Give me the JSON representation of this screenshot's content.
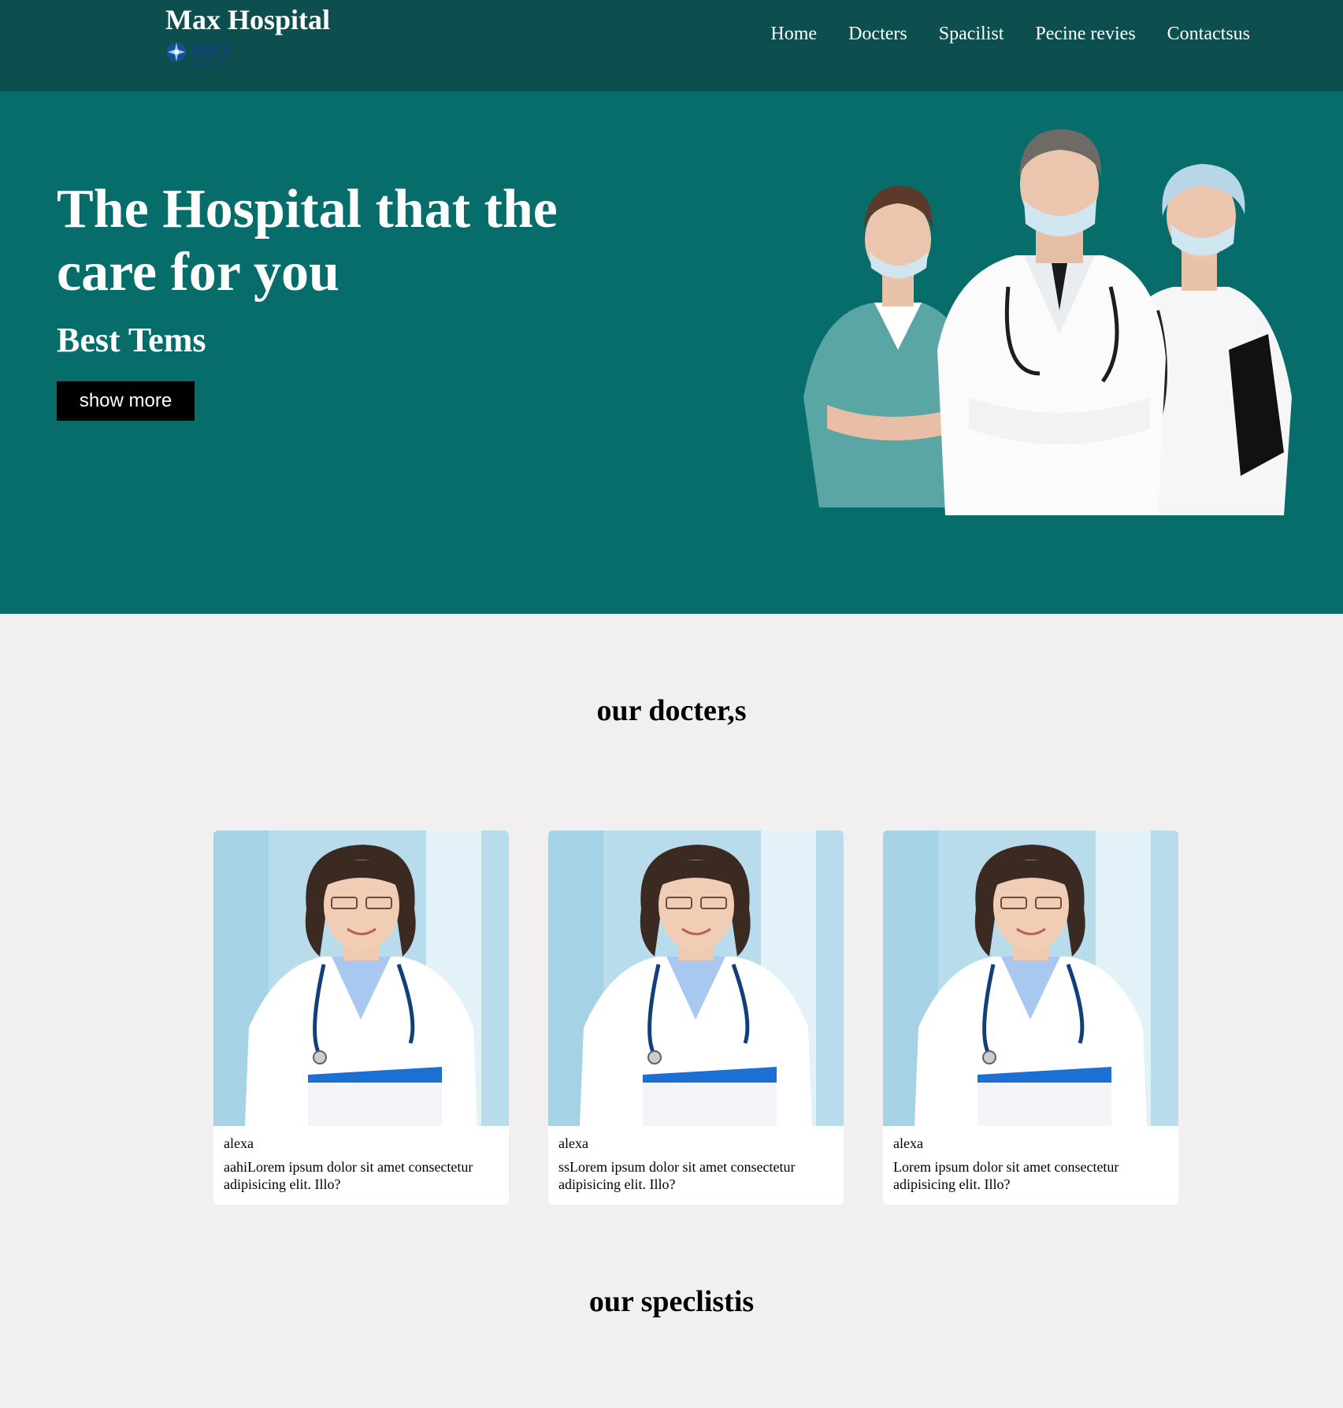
{
  "header": {
    "brand": "Max Hospital",
    "nav": [
      "Home",
      "Docters",
      "Spacilist",
      "Pecine revies",
      "Contactsus"
    ]
  },
  "hero": {
    "title": "The Hospital that the care for you",
    "subtitle": "Best Tems",
    "button": "show more"
  },
  "doctors": {
    "title": "our docter,s",
    "cards": [
      {
        "name": "alexa",
        "desc": "aahiLorem ipsum dolor sit amet consectetur adipisicing elit. Illo?"
      },
      {
        "name": "alexa",
        "desc": "ssLorem ipsum dolor sit amet consectetur adipisicing elit. Illo?"
      },
      {
        "name": "alexa",
        "desc": "Lorem ipsum dolor sit amet consectetur adipisicing elit. Illo?"
      }
    ]
  },
  "specialists": {
    "title": "our speclistis"
  },
  "colors": {
    "header_bg": "#0d4f4f",
    "hero_bg": "#076d6b",
    "page_bg": "#f1eff0",
    "button_bg": "#000000"
  }
}
